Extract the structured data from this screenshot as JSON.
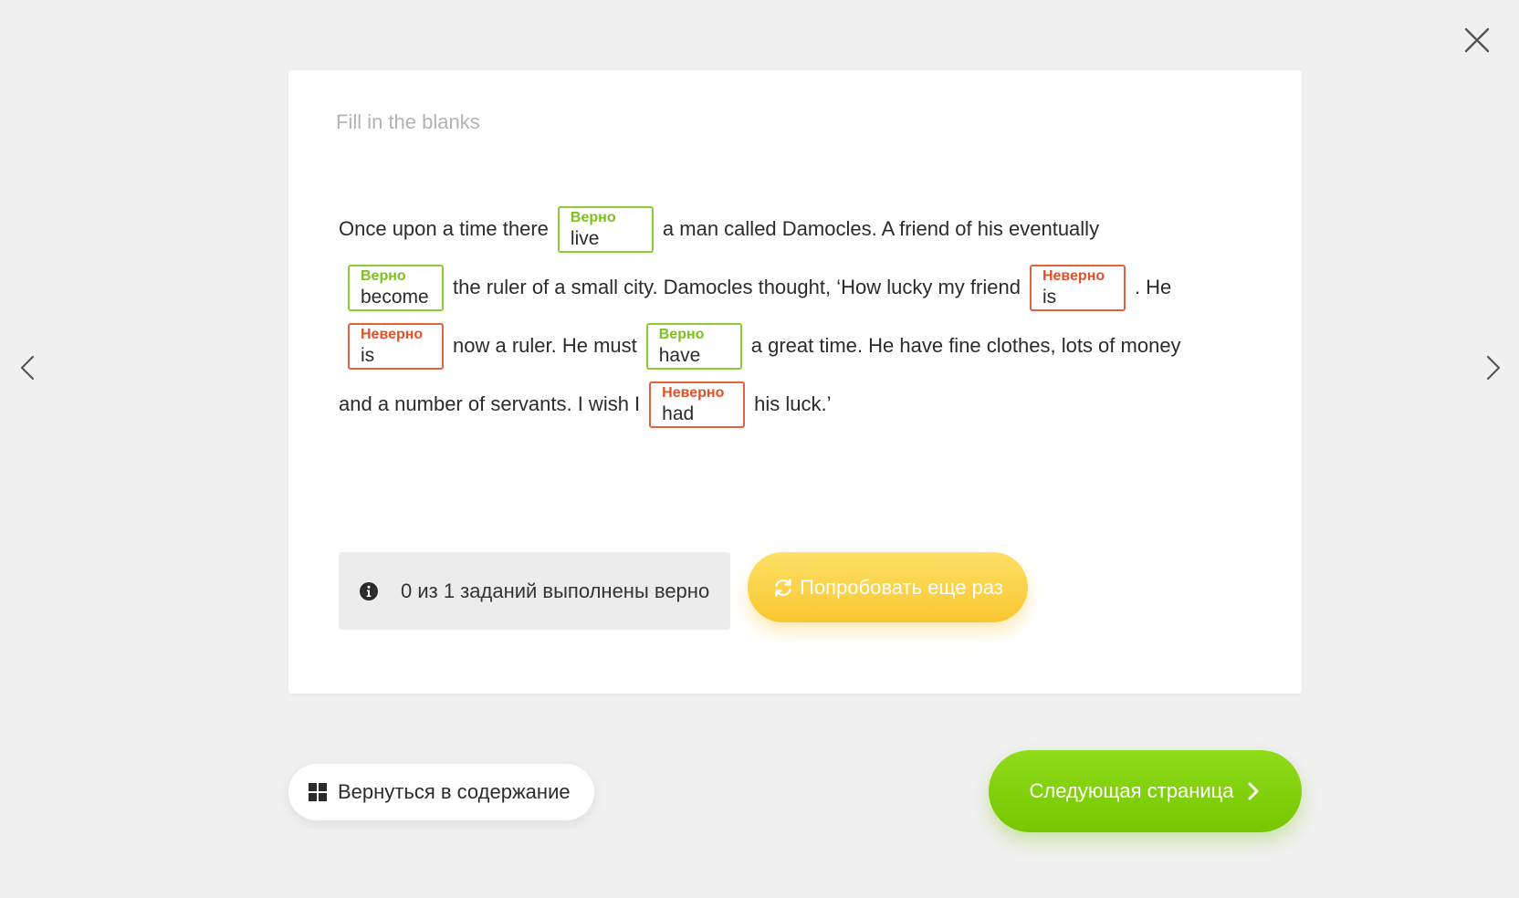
{
  "exercise": {
    "title": "Fill in the blanks",
    "lines": [
      [
        {
          "t": "Once upon a time there"
        },
        {
          "status": "Верно",
          "answer": "live",
          "correct": true
        },
        {
          "t": "a man called Damocles. A friend of his eventually"
        }
      ],
      [
        {
          "status": "Верно",
          "answer": "become",
          "correct": true
        },
        {
          "t": "the ruler of a small city. Damocles thought, ‘How lucky my friend"
        },
        {
          "status": "Неверно",
          "answer": "is",
          "correct": false
        },
        {
          "t": ". He"
        }
      ],
      [
        {
          "status": "Неверно",
          "answer": "is",
          "correct": false
        },
        {
          "t": "now a ruler. He must"
        },
        {
          "status": "Верно",
          "answer": "have",
          "correct": true
        },
        {
          "t": "a great time. He have fine clothes, lots of money"
        }
      ],
      [
        {
          "t": "and a number of servants. I wish I"
        },
        {
          "status": "Неверно",
          "answer": "had",
          "correct": false
        },
        {
          "t": "his luck.’"
        }
      ]
    ]
  },
  "result": {
    "text": "0 из 1 заданий выполнены верно",
    "icon": "info-icon"
  },
  "buttons": {
    "retry": "Попробовать еще раз",
    "toc": "Вернуться в содержание",
    "next": "Следующая страница"
  },
  "colors": {
    "correct": "#7cc21b",
    "incorrect": "#e4502a",
    "retry": "#f9c630",
    "next": "#76c600"
  }
}
